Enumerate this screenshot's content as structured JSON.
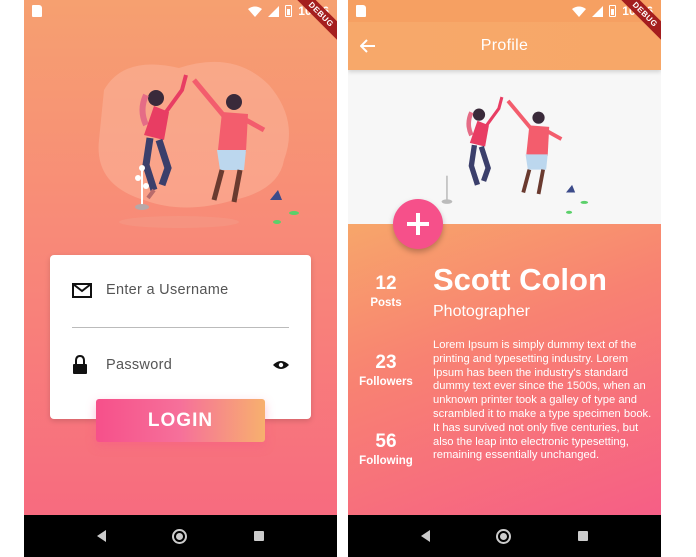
{
  "status": {
    "time": "10:36"
  },
  "debug_ribbon": "DEBUG",
  "login_screen": {
    "username_placeholder": "Enter a Username",
    "password_placeholder": "Password",
    "login_label": "LOGIN"
  },
  "profile_screen": {
    "title": "Profile",
    "name": "Scott Colon",
    "role": "Photographer",
    "stats": [
      {
        "value": "12",
        "label": "Posts"
      },
      {
        "value": "23",
        "label": "Followers"
      },
      {
        "value": "56",
        "label": "Following"
      }
    ],
    "bio": "Lorem Ipsum is simply dummy text of the printing and typesetting industry. Lorem Ipsum has been the industry's standard dummy text ever since the 1500s, when an unknown printer took a galley of type and scrambled it to make a type specimen book. It has survived not only five centuries, but also the leap into electronic typesetting, remaining essentially unchanged."
  },
  "colors": {
    "gradient_top": "#f6a070",
    "gradient_bottom": "#f76b7f",
    "accent_pink": "#f6508a",
    "appbar_orange": "#f7a86a"
  },
  "icons": [
    "sd-card-icon",
    "wifi-icon",
    "signal-icon",
    "battery-icon",
    "mail-icon",
    "lock-icon",
    "eye-icon",
    "back-arrow-icon",
    "plus-icon",
    "nav-back-icon",
    "nav-home-icon",
    "nav-recent-icon"
  ]
}
